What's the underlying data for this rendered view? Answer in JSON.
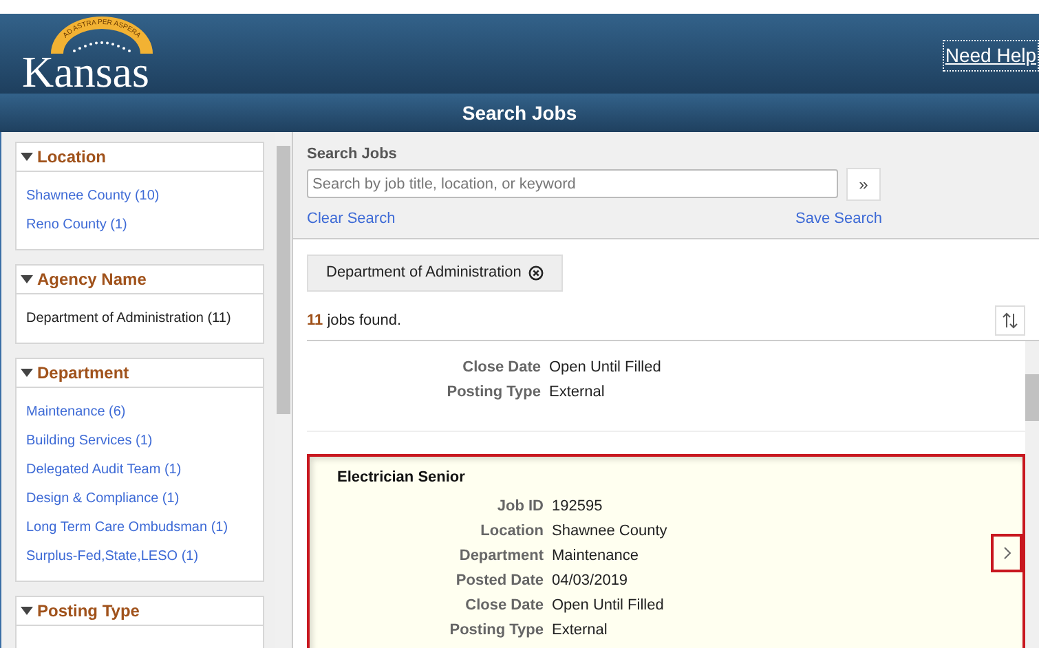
{
  "header": {
    "logo_text": "Kansas",
    "logo_motto": "AD ASTRA PER ASPERA",
    "help_link": "Need Help"
  },
  "title_bar": {
    "title": "Search Jobs"
  },
  "filters": [
    {
      "title": "Location",
      "expanded": true,
      "items": [
        {
          "label": "Shawnee County (10)",
          "kind": "link"
        },
        {
          "label": "Reno County (1)",
          "kind": "link"
        }
      ]
    },
    {
      "title": "Agency Name",
      "expanded": true,
      "items": [
        {
          "label": "Department of Administration (11)",
          "kind": "plain"
        }
      ]
    },
    {
      "title": "Department",
      "expanded": true,
      "items": [
        {
          "label": "Maintenance (6)",
          "kind": "link"
        },
        {
          "label": "Building Services (1)",
          "kind": "link"
        },
        {
          "label": "Delegated Audit Team (1)",
          "kind": "link"
        },
        {
          "label": "Design & Compliance (1)",
          "kind": "link"
        },
        {
          "label": "Long Term Care Ombudsman (1)",
          "kind": "link"
        },
        {
          "label": "Surplus-Fed,State,LESO (1)",
          "kind": "link"
        }
      ]
    },
    {
      "title": "Posting Type",
      "expanded": true
    }
  ],
  "search": {
    "label": "Search Jobs",
    "placeholder": "Search by job title, location, or keyword",
    "go_button": "»",
    "clear_link": "Clear Search",
    "save_link": "Save Search"
  },
  "active_filter": {
    "label": "Department of Administration"
  },
  "results": {
    "count": "11",
    "suffix": "jobs found."
  },
  "jobs": [
    {
      "selected": false,
      "fields": [
        {
          "label": "Close Date",
          "value": "Open Until Filled"
        },
        {
          "label": "Posting Type",
          "value": "External"
        }
      ]
    },
    {
      "title": "Electrician Senior",
      "selected": true,
      "fields": [
        {
          "label": "Job ID",
          "value": "192595"
        },
        {
          "label": "Location",
          "value": "Shawnee County"
        },
        {
          "label": "Department",
          "value": "Maintenance"
        },
        {
          "label": "Posted Date",
          "value": "04/03/2019"
        },
        {
          "label": "Close Date",
          "value": "Open Until Filled"
        },
        {
          "label": "Posting Type",
          "value": "External"
        }
      ]
    }
  ]
}
